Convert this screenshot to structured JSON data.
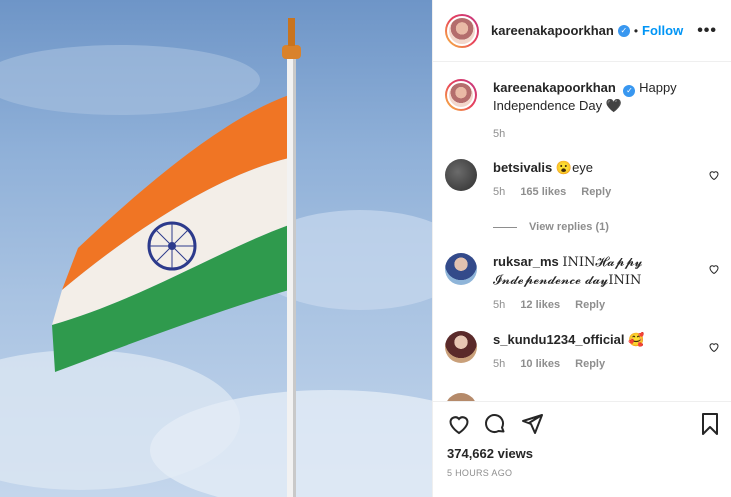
{
  "post": {
    "author": "kareenakapoorkhan",
    "follow_label": "Follow",
    "caption_text": "Happy Independence Day 🖤",
    "caption_time": "5h",
    "views": "374,662 views",
    "posted": "5 HOURS AGO"
  },
  "comments": [
    {
      "user": "betsivalis",
      "text": "😮eye",
      "time": "5h",
      "likes": "165 likes",
      "reply": "Reply"
    },
    {
      "user": "ruksar_ms",
      "text": "ININ𝓗𝓪𝓹𝓹𝔂 𝓘𝓷𝓭𝓮𝓹𝓮𝓷𝓭𝓮𝓷𝓬𝓮 𝓭𝓪𝔂ININ",
      "time": "5h",
      "likes": "12 likes",
      "reply": "Reply"
    },
    {
      "user": "s_kundu1234_official",
      "text": "🥰",
      "time": "5h",
      "likes": "10 likes",
      "reply": "Reply"
    }
  ],
  "view_replies": "View replies (1)",
  "icons": {
    "more": "more-options-icon",
    "like": "heart-icon",
    "comment": "comment-icon",
    "share": "share-icon",
    "save": "bookmark-icon"
  },
  "colors": {
    "accent": "#0095f6",
    "verified": "#3897f0",
    "muted": "#8e8e8e"
  }
}
